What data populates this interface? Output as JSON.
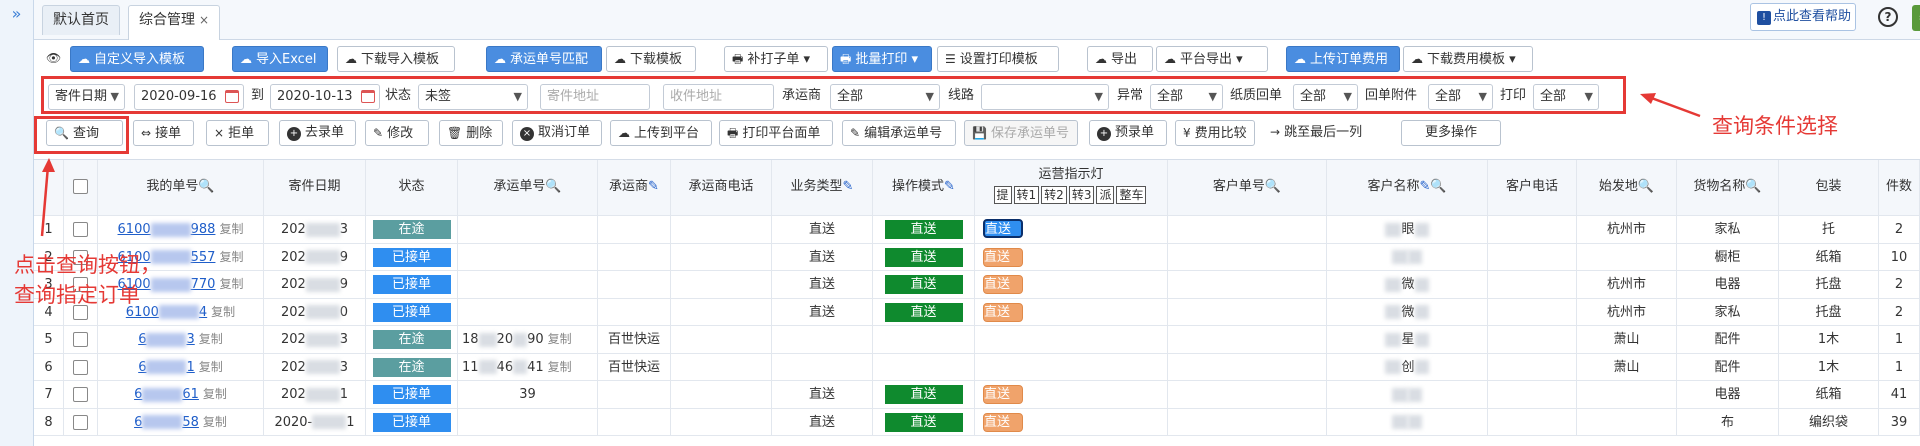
{
  "nav": {
    "expand_glyph": "»"
  },
  "tabs": [
    {
      "label": "默认首页"
    },
    {
      "label": "综合管理",
      "close": "×"
    }
  ],
  "header": {
    "help_label": "点此查看帮助",
    "help_glyph": "!",
    "question_glyph": "?",
    "settings_glyph": "⚙"
  },
  "toolbar1": [
    {
      "label": "自定义导入模板",
      "icon": "☁"
    },
    {
      "label": "导入Excel",
      "icon": "☁"
    },
    {
      "label": "下载导入模板",
      "icon": "☁"
    },
    {
      "label": "承运单号匹配",
      "icon": "☁"
    },
    {
      "label": "下载模板",
      "icon": "☁"
    },
    {
      "label": "补打子单",
      "icon": "🖶"
    },
    {
      "label": "批量打印",
      "icon": "🖶"
    },
    {
      "label": "设置打印模板",
      "icon": "☰"
    },
    {
      "label": "导出",
      "icon": "☁"
    },
    {
      "label": "平台导出",
      "icon": "☁"
    },
    {
      "label": "上传订单费用",
      "icon": "☁"
    },
    {
      "label": "下载费用模板",
      "icon": "☁"
    }
  ],
  "filters": {
    "date_type": "寄件日期",
    "date_from": "2020-09-16",
    "to_label": "到",
    "date_to": "2020-10-13",
    "status_label": "状态",
    "status_value": "未签",
    "sender_addr_ph": "寄件地址",
    "receiver_addr_ph": "收件地址",
    "carrier_label": "承运商",
    "carrier_value": "全部",
    "route_label": "线路",
    "route_value": "",
    "exception_label": "异常",
    "exception_value": "全部",
    "paper_label": "纸质回单",
    "paper_value": "全部",
    "receipt_attach_label": "回单附件",
    "receipt_attach_value": "全部",
    "print_label": "打印",
    "print_value": "全部",
    "arrow": "▼"
  },
  "toolbar2": [
    {
      "label": "查询",
      "icon": "🔍"
    },
    {
      "label": "接单",
      "icon": "⇔"
    },
    {
      "label": "拒单",
      "icon": "×"
    },
    {
      "label": "去录单",
      "icon": "+"
    },
    {
      "label": "修改",
      "icon": "✎"
    },
    {
      "label": "删除",
      "icon": "🗑"
    },
    {
      "label": "取消订单",
      "icon": "×"
    },
    {
      "label": "上传到平台",
      "icon": "☁"
    },
    {
      "label": "打印平台面单",
      "icon": "🖶"
    },
    {
      "label": "编辑承运单号",
      "icon": "✎"
    },
    {
      "label": "保存承运单号",
      "icon": "💾"
    },
    {
      "label": "预录单",
      "icon": "+"
    },
    {
      "label": "费用比较",
      "icon": "¥"
    },
    {
      "label": "跳至最后一列",
      "icon": "→"
    },
    {
      "label": "更多操作",
      "icon": ""
    }
  ],
  "columns": {
    "my_no": "我的单号",
    "send_date": "寄件日期",
    "status": "状态",
    "carrier_no": "承运单号",
    "carrier": "承运商",
    "carrier_phone": "承运商电话",
    "biz_type": "业务类型",
    "op_mode": "操作模式",
    "lamp_title": "运营指示灯",
    "lamp_btns": [
      "提",
      "转1",
      "转2",
      "转3",
      "派",
      "整车"
    ],
    "cust_no": "客户单号",
    "cust_name": "客户名称",
    "cust_phone": "客户电话",
    "origin": "始发地",
    "goods": "货物名称",
    "package": "包装",
    "pieces": "件数"
  },
  "icons": {
    "search": "search-icon",
    "edit": "pencil-icon"
  },
  "rows": [
    {
      "idx": "1",
      "my_no": "6100",
      "my_no2": "988",
      "copy": "复制",
      "date_a": "202",
      "date_b": "3",
      "status": "在途",
      "status_color": "green",
      "carrier_no": "",
      "carrier_no_copy": "",
      "carrier": "",
      "biz": "直送",
      "mode": "直送",
      "lamp": "直送",
      "lamp_type": "sel",
      "cust_name": "眼",
      "origin": "杭州市",
      "goods": "家私",
      "package": "托",
      "pieces": "2"
    },
    {
      "idx": "2",
      "my_no": "6100",
      "my_no2": "557",
      "copy": "复制",
      "date_a": "202",
      "date_b": "9",
      "status": "已接单",
      "status_color": "blue",
      "carrier_no": "",
      "carrier_no_copy": "",
      "carrier": "",
      "biz": "直送",
      "mode": "直送",
      "lamp": "直送",
      "lamp_type": "org",
      "cust_name": "",
      "origin": "",
      "goods": "橱柜",
      "package": "纸箱",
      "pieces": "10"
    },
    {
      "idx": "3",
      "my_no": "6100",
      "my_no2": "770",
      "copy": "复制",
      "date_a": "202",
      "date_b": "9",
      "status": "已接单",
      "status_color": "blue",
      "carrier_no": "",
      "carrier_no_copy": "",
      "carrier": "",
      "biz": "直送",
      "mode": "直送",
      "lamp": "直送",
      "lamp_type": "org",
      "cust_name": "微",
      "origin": "杭州市",
      "goods": "电器",
      "package": "托盘",
      "pieces": "2"
    },
    {
      "idx": "4",
      "my_no": "6100",
      "my_no2": "4",
      "copy": "复制",
      "date_a": "202",
      "date_b": "0",
      "status": "已接单",
      "status_color": "blue",
      "carrier_no": "",
      "carrier_no_copy": "",
      "carrier": "",
      "biz": "直送",
      "mode": "直送",
      "lamp": "直送",
      "lamp_type": "org",
      "cust_name": "微",
      "origin": "杭州市",
      "goods": "家私",
      "package": "托盘",
      "pieces": "2"
    },
    {
      "idx": "5",
      "my_no": "6",
      "my_no2": "3",
      "copy": "复制",
      "date_a": "202",
      "date_b": "3",
      "status": "在途",
      "status_color": "green",
      "carrier_no": "18",
      "carrier_no2": "20",
      "carrier_no3": "90",
      "carrier_no_copy": "复制",
      "carrier": "百世快运",
      "biz": "",
      "mode": "",
      "lamp": "",
      "lamp_type": "",
      "cust_name": "星",
      "origin": "萧山",
      "goods": "配件",
      "package": "1木",
      "pieces": "1"
    },
    {
      "idx": "6",
      "my_no": "6",
      "my_no2": "1",
      "copy": "复制",
      "date_a": "202",
      "date_b": "3",
      "status": "在途",
      "status_color": "green",
      "carrier_no": "11",
      "carrier_no2": "46",
      "carrier_no3": "41",
      "carrier_no_copy": "复制",
      "carrier": "百世快运",
      "biz": "",
      "mode": "",
      "lamp": "",
      "lamp_type": "",
      "cust_name": "创",
      "origin": "萧山",
      "goods": "配件",
      "package": "1木",
      "pieces": "1"
    },
    {
      "idx": "7",
      "my_no": "6",
      "my_no2": "61",
      "copy": "复制",
      "date_a": "202",
      "date_b": "1",
      "status": "已接单",
      "status_color": "blue",
      "carrier_no": "39",
      "carrier_no_copy": "",
      "carrier": "",
      "biz": "直送",
      "mode": "直送",
      "lamp": "直送",
      "lamp_type": "org",
      "cust_name": "",
      "origin": "",
      "goods": "电器",
      "package": "纸箱",
      "pieces": "41"
    },
    {
      "idx": "8",
      "my_no": "6",
      "my_no2": "58",
      "copy": "复制",
      "date_a": "2020-",
      "date_b": "1",
      "status": "已接单",
      "status_color": "blue",
      "carrier_no": "",
      "carrier_no_copy": "",
      "carrier": "",
      "biz": "直送",
      "mode": "直送",
      "lamp": "直送",
      "lamp_type": "org",
      "cust_name": "",
      "origin": "",
      "goods": "布",
      "package": "编织袋",
      "pieces": "39"
    }
  ],
  "annotations": {
    "filter_note": "查询条件选择",
    "query_note_1": "点击查询按钮，",
    "query_note_2": "查询指定订单"
  },
  "colors": {
    "accent": "#4a8de0",
    "annotation": "#e53935",
    "status_green": "#5b9ea0",
    "status_blue": "#2f8ef0",
    "mode_green": "#0f8a2e",
    "lamp_orange": "#f0a36b"
  }
}
